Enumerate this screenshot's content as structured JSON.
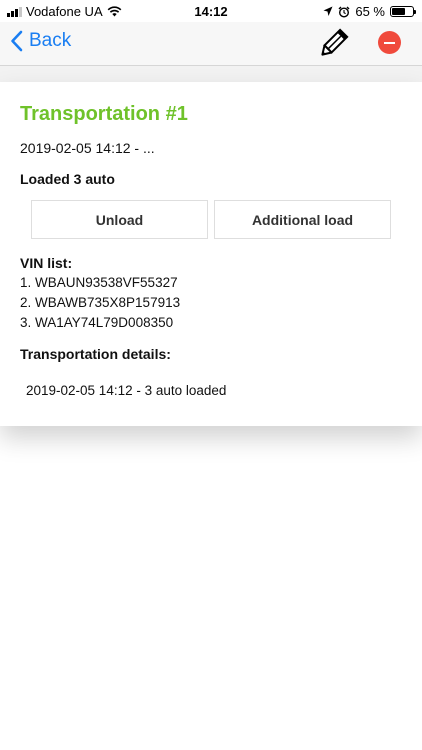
{
  "status_bar": {
    "carrier": "Vodafone UA",
    "time": "14:12",
    "battery": "65 %",
    "battery_level": 0.65,
    "signal_bars": 3,
    "icons": [
      "signal-icon",
      "wifi-icon",
      "location-arrow-icon",
      "alarm-icon",
      "battery-icon"
    ]
  },
  "nav": {
    "back_label": "Back",
    "icons": [
      "chevron-left-icon",
      "pencil-icon",
      "delete-icon"
    ],
    "accent_color": "#1a7ef2",
    "delete_color": "#f04a3c"
  },
  "transport": {
    "title": "Transportation #1",
    "title_color": "#6fc22a",
    "date_range": "2019-02-05 14:12 - ...",
    "loaded_text": "Loaded 3 auto",
    "unload_label": "Unload",
    "additional_load_label": "Additional load",
    "vin_heading": "VIN list:",
    "vins": [
      "1. WBAUN93538VF55327",
      "2. WBAWB735X8P157913",
      "3. WA1AY74L79D008350"
    ],
    "details_heading": "Transportation details:",
    "details": [
      "2019-02-05 14:12 - 3 auto loaded"
    ]
  }
}
